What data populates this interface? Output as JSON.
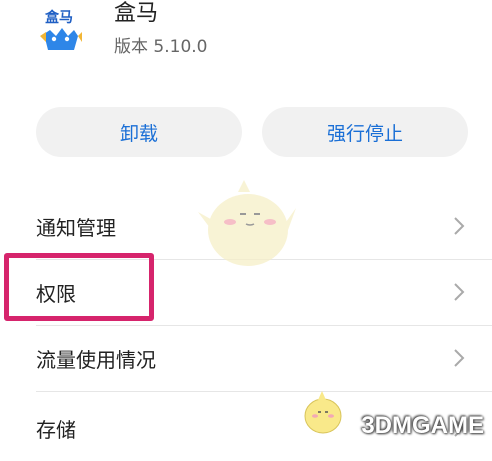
{
  "app": {
    "icon_text": "盒马",
    "name": "盒马",
    "version": "版本 5.10.0"
  },
  "buttons": {
    "uninstall": "卸载",
    "force_stop": "强行停止"
  },
  "settings": [
    {
      "label": "通知管理"
    },
    {
      "label": "权限"
    },
    {
      "label": "流量使用情况"
    },
    {
      "label": "存储"
    }
  ],
  "watermark": {
    "text": "3DMGAME"
  },
  "colors": {
    "accent": "#1a6fd6",
    "highlight": "#d6246c",
    "button_bg": "#f1f1f1"
  }
}
